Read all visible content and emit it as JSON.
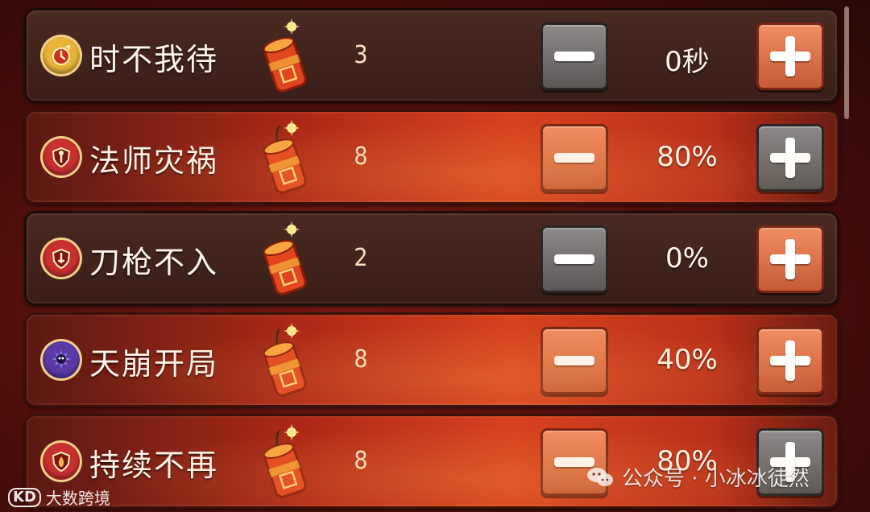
{
  "rows": [
    {
      "name": "时不我待",
      "count": "3",
      "value": "0秒",
      "style": "dark",
      "badge": "clock-icon",
      "badgeColor": "#e8b53a",
      "minusStyle": "gray",
      "plusStyle": "orange"
    },
    {
      "name": "法师灾祸",
      "count": "8",
      "value": "80%",
      "style": "active",
      "badge": "shield-staff-icon",
      "badgeColor": "#c93030",
      "minusStyle": "orange",
      "plusStyle": "gray"
    },
    {
      "name": "刀枪不入",
      "count": "2",
      "value": "0%",
      "style": "dark",
      "badge": "shield-sword-icon",
      "badgeColor": "#c93030",
      "minusStyle": "gray",
      "plusStyle": "orange"
    },
    {
      "name": "天崩开局",
      "count": "8",
      "value": "40%",
      "style": "active",
      "badge": "skull-burst-icon",
      "badgeColor": "#5b3aa8",
      "minusStyle": "orange",
      "plusStyle": "orange"
    },
    {
      "name": "持续不再",
      "count": "8",
      "value": "80%",
      "style": "active",
      "badge": "shield-flame-icon",
      "badgeColor": "#c93030",
      "minusStyle": "orange",
      "plusStyle": "gray"
    }
  ],
  "watermarks": {
    "left_logo": "ℹ︎",
    "left_text": "大数跨境",
    "right_text": "公众号 · 小冰冰徒然"
  },
  "colors": {
    "accent_orange": "#d8421f",
    "button_gray": "#6f6c6b",
    "button_orange": "#dc7048"
  }
}
